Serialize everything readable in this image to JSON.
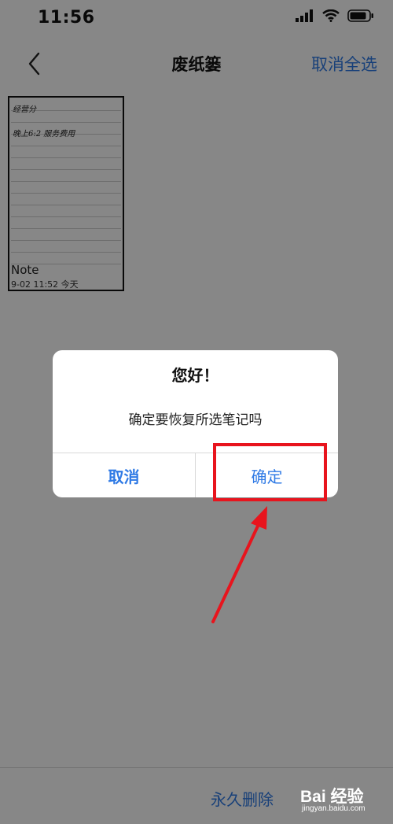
{
  "status_bar": {
    "time": "11:56",
    "icons": [
      "signal-icon",
      "wifi-icon",
      "battery-icon"
    ]
  },
  "nav": {
    "back_icon": "chevron-left-icon",
    "title": "废纸篓",
    "action": "取消全选"
  },
  "note_card": {
    "handwriting_lines": [
      "经营分",
      "晚上6:2 服务费用"
    ],
    "name": "Note",
    "date": "9-02 11:52  今天"
  },
  "bottom_bar": {
    "action": "永久删除"
  },
  "watermark": {
    "text": "Bai 经验",
    "url": "jingyan.baidu.com"
  },
  "dialog": {
    "title": "您好！",
    "message": "确定要恢复所选笔记吗",
    "cancel_label": "取消",
    "confirm_label": "确定"
  },
  "colors": {
    "accent": "#2f7ae5",
    "annotation": "#e8141d",
    "overlay": "rgba(0,0,0,0.47)"
  }
}
